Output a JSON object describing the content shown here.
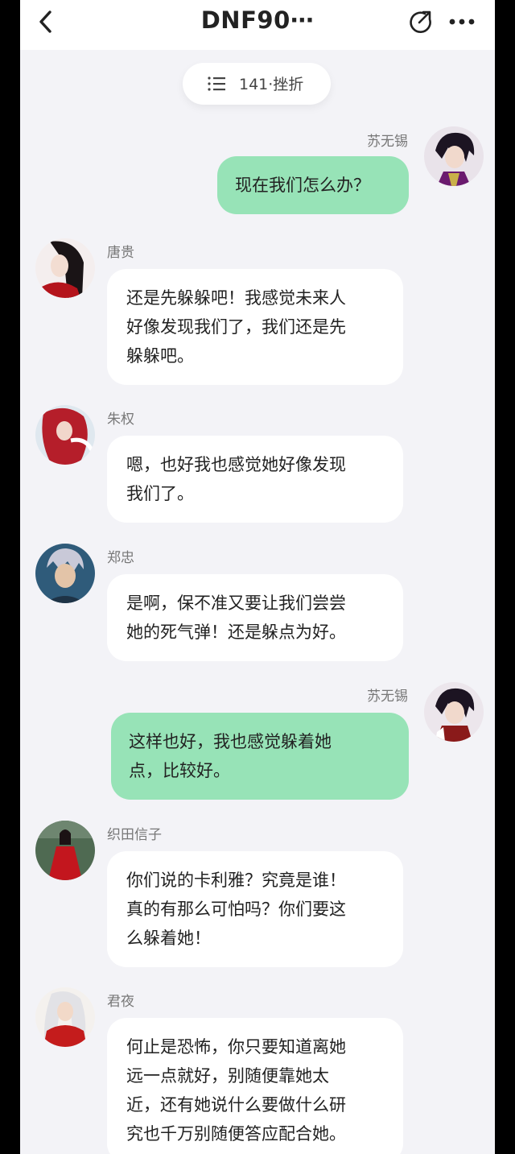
{
  "header": {
    "title": "DNF90⋯",
    "back_icon": "chevron-left-icon",
    "share_icon": "share-arrow-icon",
    "more_icon": "more-dots-icon"
  },
  "chip": {
    "icon": "list-icon",
    "text": "141·挫折"
  },
  "colors": {
    "outgoing_bubble": "#97e3b7",
    "incoming_bubble": "#ffffff",
    "background": "#f3f3f7"
  },
  "messages": [
    {
      "sender": "苏无锡",
      "direction": "out",
      "lines": [
        "现在我们怎么办？"
      ]
    },
    {
      "sender": "唐贵",
      "direction": "in",
      "lines": [
        "还是先躲躲吧！我感觉未来人",
        "好像发现我们了，我们还是先",
        "躲躲吧。"
      ]
    },
    {
      "sender": "朱权",
      "direction": "in",
      "lines": [
        "嗯，也好我也感觉她好像发现",
        "我们了。"
      ]
    },
    {
      "sender": "郑忠",
      "direction": "in",
      "lines": [
        "是啊，保不准又要让我们尝尝",
        "她的死气弹！还是躲点为好。"
      ]
    },
    {
      "sender": "苏无锡",
      "direction": "out",
      "lines": [
        "这样也好，我也感觉躲着她",
        "点，比较好。"
      ]
    },
    {
      "sender": "织田信子",
      "direction": "in",
      "lines": [
        "你们说的卡利雅？究竟是谁！",
        "真的有那么可怕吗？你们要这",
        "么躲着她！"
      ]
    },
    {
      "sender": "君夜",
      "direction": "in",
      "lines": [
        "何止是恐怖，你只要知道离她",
        "远一点就好，别随便靠她太",
        "近，还有她说什么要做什么研",
        "究也千万别随便答应配合她。"
      ]
    }
  ]
}
